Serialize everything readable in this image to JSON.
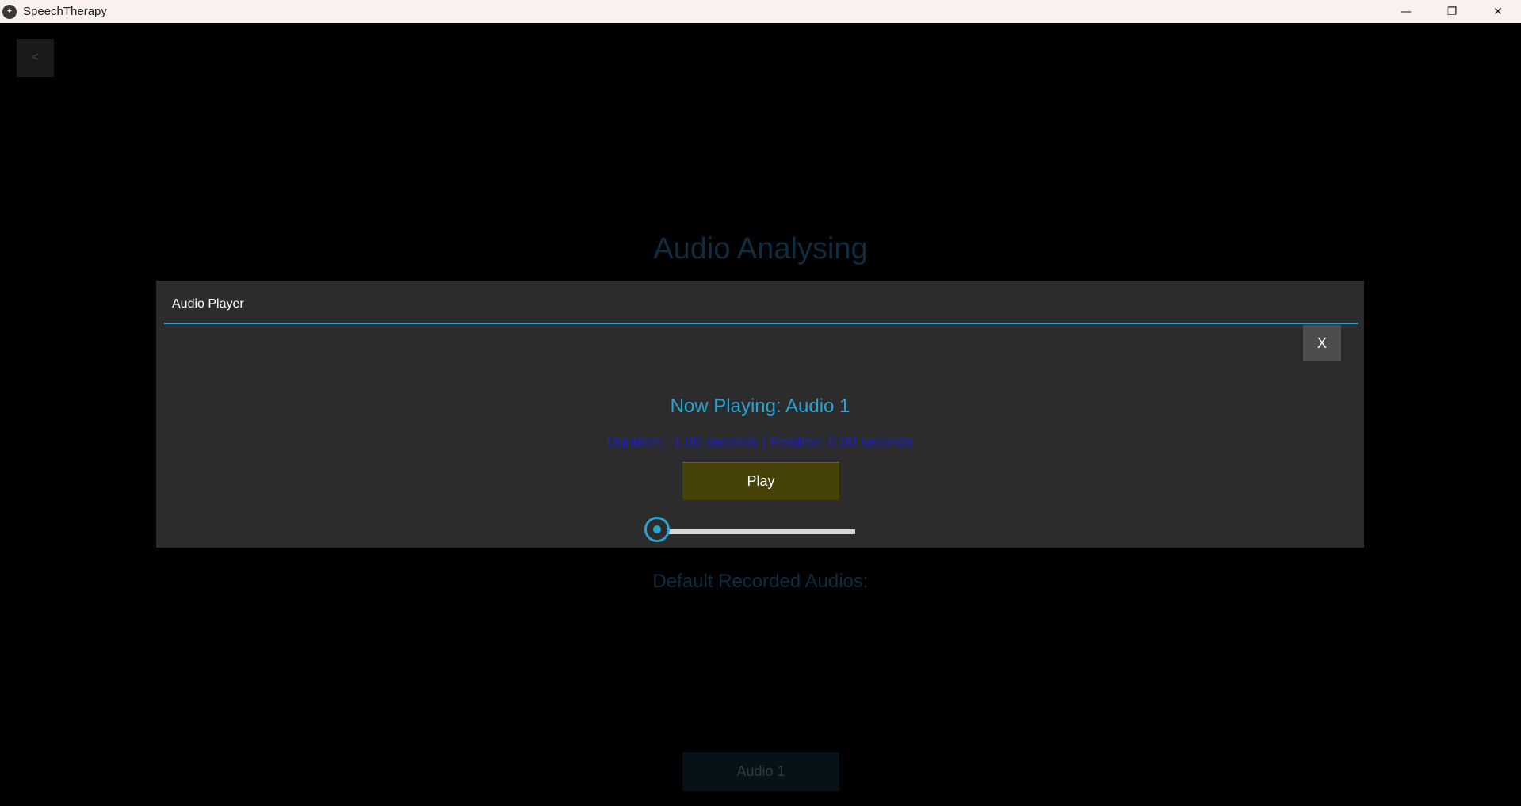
{
  "window": {
    "app_icon": "kivy-logo-icon",
    "title": "SpeechTherapy",
    "minimize_glyph": "—",
    "restore_glyph": "❐",
    "close_glyph": "✕"
  },
  "screen": {
    "back_label": "<",
    "title": "Audio Analysing",
    "section_title": "Default Recorded Audios:",
    "audio_items": [
      "Audio 1"
    ]
  },
  "dialog": {
    "title": "Audio Player",
    "close_label": "X",
    "now_playing": "Now Playing: Audio 1",
    "info": "Duration: -1.00 seconds | Position: 0.00 seconds",
    "play_label": "Play",
    "slider_value_fraction": 0.0
  },
  "colors": {
    "accent": "#2ba1d1",
    "info_text": "#1e1ec8",
    "play_button": "#474208",
    "dialog_bg": "#2c2c2c",
    "dimmed_title": "#0f2c40"
  }
}
